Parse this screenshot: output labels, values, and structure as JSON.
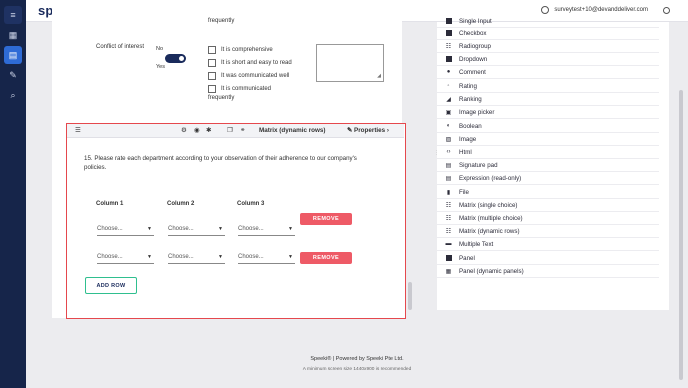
{
  "app": {
    "logo_main": "speeki",
    "logo_accent": "",
    "user_email": "surveytest+10@devanddeliver.com"
  },
  "colors": {
    "nav_bg": "#16254a",
    "nav_active": "#2e6bd6",
    "accent_green": "#2fbf8f",
    "danger": "#ee5a66",
    "highlight_border": "#e5484d",
    "toggle_on": "#1a2b5c"
  },
  "leftnav": {
    "items": [
      {
        "name": "menu-icon",
        "glyph": "≡"
      },
      {
        "name": "dashboard-icon",
        "glyph": "▦"
      },
      {
        "name": "surveys-icon",
        "glyph": "▤"
      },
      {
        "name": "edit-icon",
        "glyph": "✎"
      },
      {
        "name": "search-icon",
        "glyph": "⌕"
      }
    ]
  },
  "previous_question": {
    "top_fragment": "frequently",
    "label": "Conflict of interest",
    "toggle_no": "No",
    "toggle_yes": "Yes",
    "options": [
      "It is comprehensive",
      "It is short and easy to read",
      "It was communicated well",
      "It is communicated"
    ],
    "bottom_fragment": "frequently"
  },
  "question": {
    "type_label": "Matrix (dynamic rows)",
    "properties_label": "Properties",
    "title": "15.   Please rate each department according to your observation of their adherence to our company's policies.",
    "columns": [
      "Column 1",
      "Column 2",
      "Column 3"
    ],
    "rows": [
      {
        "cells": [
          "Choose...",
          "Choose...",
          "Choose..."
        ],
        "remove_label": "REMOVE"
      },
      {
        "cells": [
          "Choose...",
          "Choose...",
          "Choose..."
        ],
        "remove_label": "REMOVE"
      }
    ],
    "add_row_label": "ADD ROW"
  },
  "toolbox": {
    "items": [
      {
        "label": "Single Input",
        "icon": "input-icon"
      },
      {
        "label": "Checkbox",
        "icon": "checkbox-icon"
      },
      {
        "label": "Radiogroup",
        "icon": "radiogroup-icon"
      },
      {
        "label": "Dropdown",
        "icon": "dropdown-icon"
      },
      {
        "label": "Comment",
        "icon": "comment-icon"
      },
      {
        "label": "Rating",
        "icon": "rating-icon"
      },
      {
        "label": "Ranking",
        "icon": "ranking-icon"
      },
      {
        "label": "Image picker",
        "icon": "image-picker-icon"
      },
      {
        "label": "Boolean",
        "icon": "boolean-icon"
      },
      {
        "label": "Image",
        "icon": "image-icon"
      },
      {
        "label": "Html",
        "icon": "html-icon"
      },
      {
        "label": "Signature pad",
        "icon": "signature-icon"
      },
      {
        "label": "Expression (read-only)",
        "icon": "expression-icon"
      },
      {
        "label": "File",
        "icon": "file-icon"
      },
      {
        "label": "Matrix (single choice)",
        "icon": "matrix-single-icon"
      },
      {
        "label": "Matrix (multiple choice)",
        "icon": "matrix-multiple-icon"
      },
      {
        "label": "Matrix (dynamic rows)",
        "icon": "matrix-dynamic-icon"
      },
      {
        "label": "Multiple Text",
        "icon": "multiple-text-icon"
      },
      {
        "label": "Panel",
        "icon": "panel-icon"
      },
      {
        "label": "Panel (dynamic panels)",
        "icon": "panel-dynamic-icon"
      }
    ]
  },
  "footer": {
    "line1": "Speeki® | Powered by Speeki Pte Ltd.",
    "line2": "A minimum screen size 1440x900 is recommended"
  }
}
